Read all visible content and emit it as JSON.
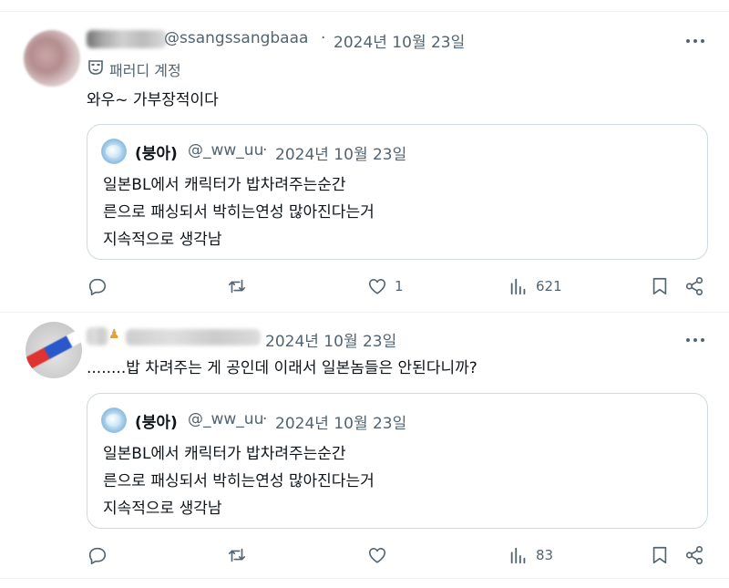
{
  "tweets": [
    {
      "handle": "@ssangssangbaaa",
      "separator": "·",
      "date": "2024년 10월 23일",
      "badge": "패러디 계정",
      "text": "와우~ 가부장적이다",
      "quote": {
        "name": "(붕아)",
        "handle": "@_ww_uu",
        "separator": "·",
        "date": "2024년 10월 23일",
        "lines": [
          "일본BL에서 캐릭터가 밥차려주는순간",
          "른으로 패싱되서 박히는연성 많아진다는거",
          "지속적으로 생각남"
        ]
      },
      "actions": {
        "replies": "",
        "retweets": "",
        "likes": "1",
        "views": "621"
      }
    },
    {
      "handle": "",
      "separator": "",
      "date": "2024년 10월 23일",
      "text": "........밥 차려주는 게 공인데 이래서 일본놈들은 안된다니까?",
      "quote": {
        "name": "(붕아)",
        "handle": "@_ww_uu",
        "separator": "·",
        "date": "2024년 10월 23일",
        "lines": [
          "일본BL에서 캐릭터가 밥차려주는순간",
          "른으로 패싱되서 박히는연성 많아진다는거",
          "지속적으로 생각남"
        ]
      },
      "actions": {
        "replies": "",
        "retweets": "",
        "likes": "",
        "views": "83"
      }
    }
  ],
  "icons": [
    "reply-icon",
    "retweet-icon",
    "like-icon",
    "views-icon",
    "bookmark-icon",
    "share-icon",
    "more-icon",
    "parody-mask-icon"
  ],
  "colors": {
    "text": "#0f1419",
    "secondary": "#536471",
    "border": "#cfd9de"
  }
}
